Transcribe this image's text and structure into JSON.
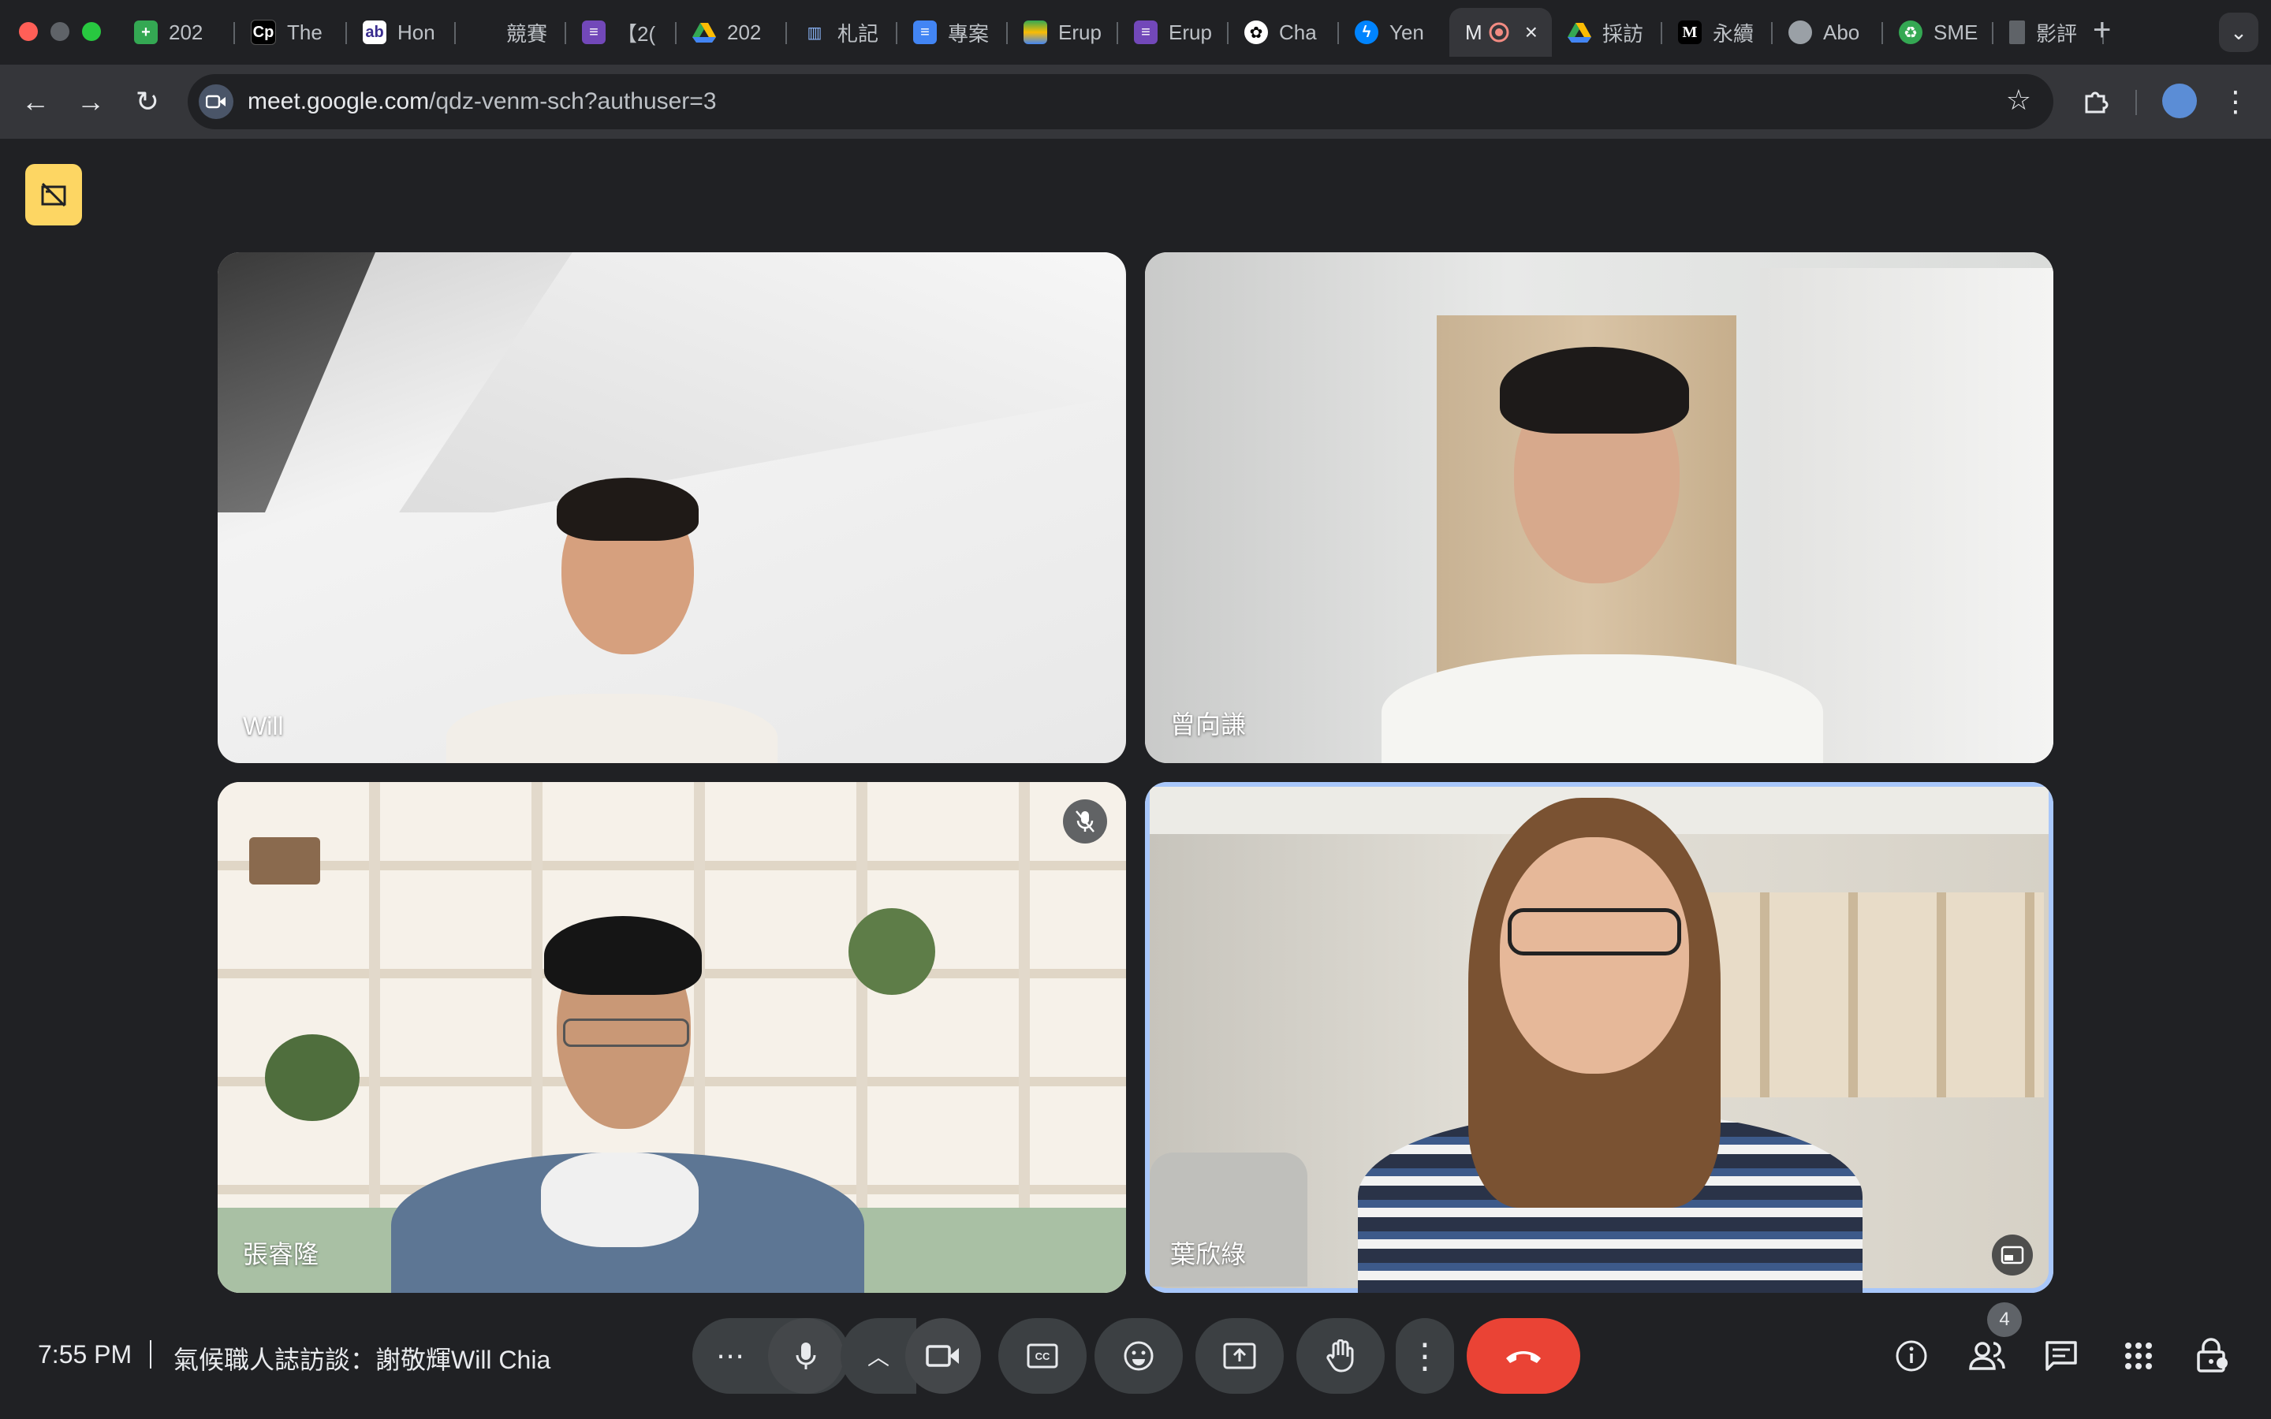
{
  "browser": {
    "tabs": [
      {
        "label": "202",
        "icon": "sheets-icon",
        "color": "#34a853"
      },
      {
        "label": "The",
        "icon": "cp-icon",
        "color": "#000000"
      },
      {
        "label": "Hon",
        "icon": "ab-icon",
        "color": "#ffffff"
      },
      {
        "label": "競賽",
        "icon": "blank-icon",
        "color": "#202124"
      },
      {
        "label": "【2(",
        "icon": "forms-icon",
        "color": "#7248b9"
      },
      {
        "label": "202",
        "icon": "drive-icon",
        "color": "#fbbc04"
      },
      {
        "label": "札記",
        "icon": "chart-icon",
        "color": "#8ab4f8"
      },
      {
        "label": "專案",
        "icon": "docs-icon",
        "color": "#4285f4"
      },
      {
        "label": "Erup",
        "icon": "stack-icon",
        "color": "#34a853"
      },
      {
        "label": "Erup",
        "icon": "forms-icon",
        "color": "#7248b9"
      },
      {
        "label": "Cha",
        "icon": "openai-icon",
        "color": "#ffffff"
      },
      {
        "label": "Yen",
        "icon": "messenger-icon",
        "color": "#0084ff"
      },
      {
        "label": "M",
        "icon": "record-icon",
        "color": "#f28b82",
        "active": true
      },
      {
        "label": "採訪",
        "icon": "drive-icon",
        "color": "#fbbc04"
      },
      {
        "label": "永續",
        "icon": "medium-icon",
        "color": "#000000"
      },
      {
        "label": "Abo",
        "icon": "globe-icon",
        "color": "#9aa0a6"
      },
      {
        "label": "SME",
        "icon": "recycle-icon",
        "color": "#34a853"
      },
      {
        "label": "影評",
        "icon": "film-icon",
        "color": "#5f6368"
      }
    ],
    "url_host": "meet.google.com",
    "url_path": "/qdz-venm-sch?authuser=3"
  },
  "meeting": {
    "participants": [
      {
        "name": "Will",
        "muted": false,
        "speaking": false
      },
      {
        "name": "曾向謙",
        "muted": false,
        "speaking": false
      },
      {
        "name": "張睿隆",
        "muted": true,
        "speaking": false
      },
      {
        "name": "葉欣綠",
        "muted": false,
        "speaking": true
      }
    ],
    "time": "7:55 PM",
    "title": "氣候職人誌訪談：謝敬輝Will Chia",
    "people_count": "4",
    "hangup_color": "#ea4335",
    "speaking_outline_color": "#a8c7fa",
    "badge_color": "#fdd663"
  }
}
